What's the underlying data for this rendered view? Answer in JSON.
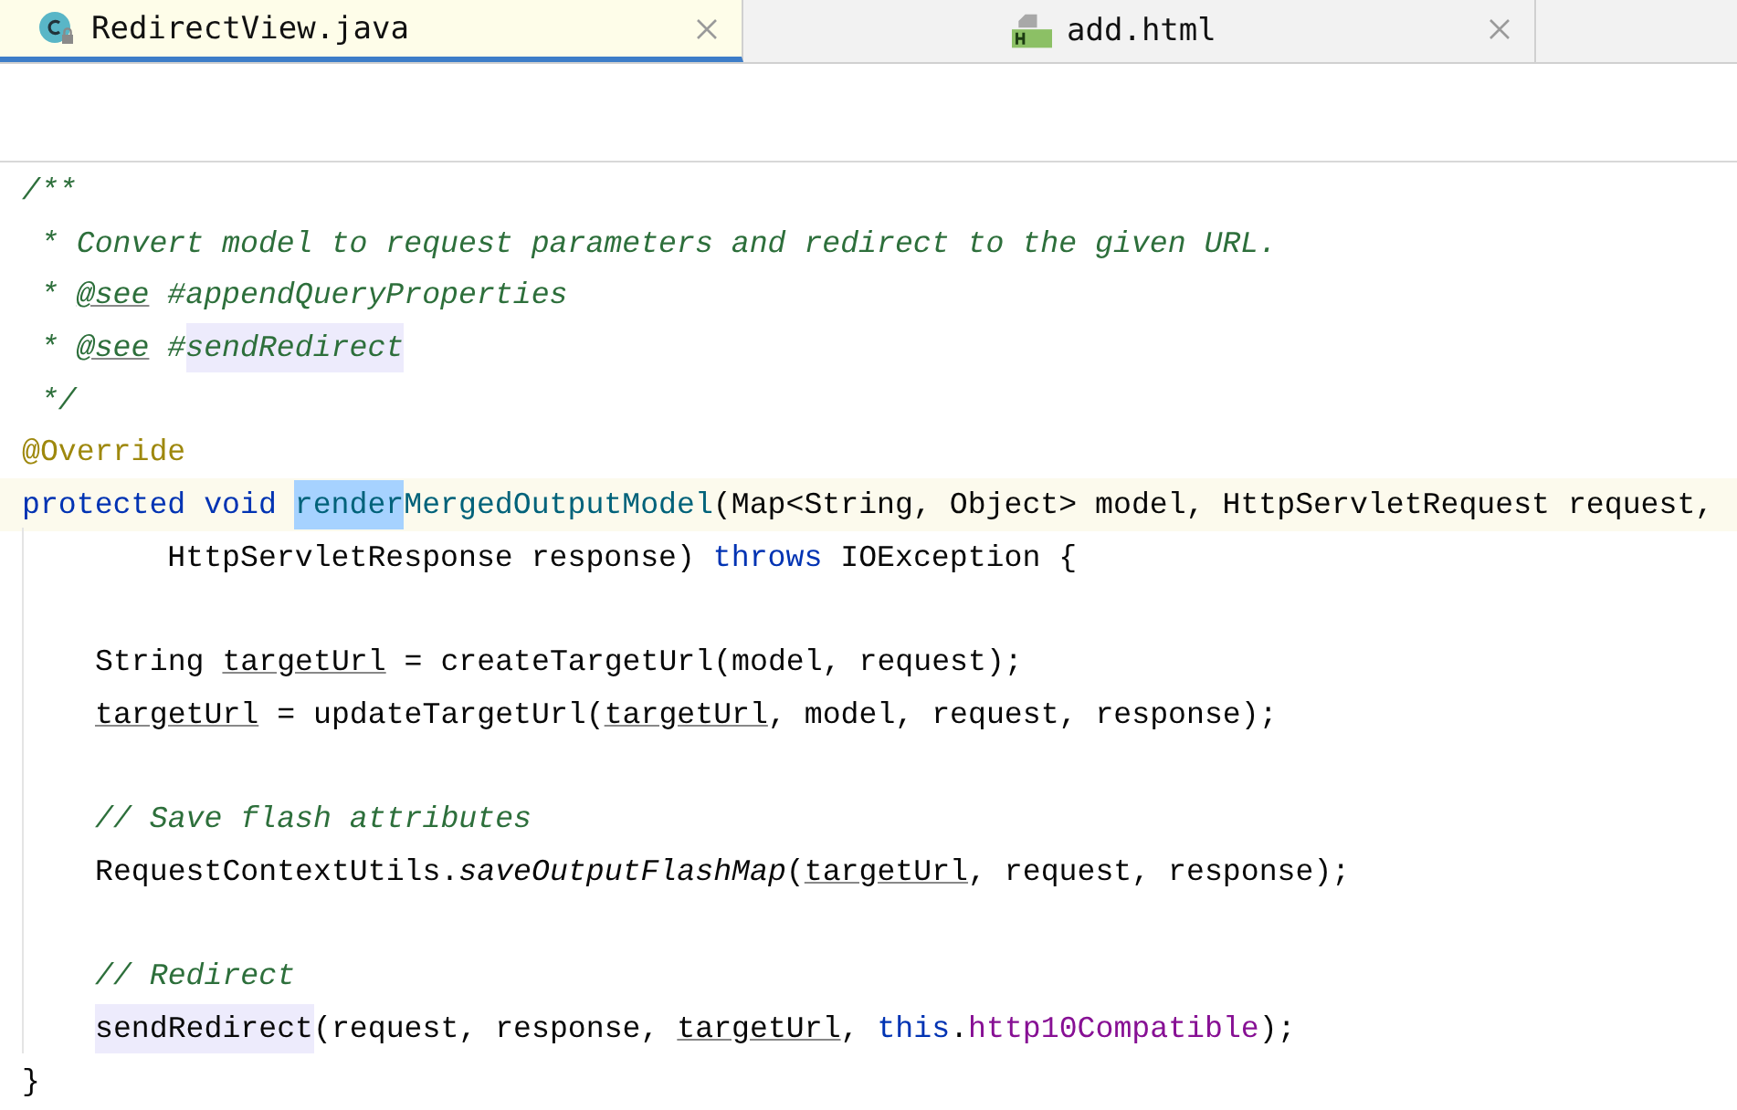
{
  "tabs": [
    {
      "label": "RedirectView.java",
      "kind": "java",
      "selected": true
    },
    {
      "label": "add.html",
      "kind": "html",
      "selected": false
    }
  ],
  "editor": {
    "lines": [
      {
        "kind": "code",
        "tokens": [
          {
            "kind": "comment",
            "text": "/**"
          }
        ]
      },
      {
        "kind": "code",
        "tokens": [
          {
            "kind": "comment",
            "text": " * Convert model to request parameters and redirect to the given URL."
          }
        ]
      },
      {
        "kind": "code",
        "tokens": [
          {
            "kind": "comment",
            "text": " * "
          },
          {
            "kind": "doctag",
            "text": "@see"
          },
          {
            "kind": "comment",
            "text": " #appendQueryProperties"
          }
        ]
      },
      {
        "kind": "code",
        "tokens": [
          {
            "kind": "comment",
            "text": " * "
          },
          {
            "kind": "doctag",
            "text": "@see"
          },
          {
            "kind": "comment",
            "text": " #"
          },
          {
            "kind": "comment-usage",
            "text": "sendRedirect"
          }
        ]
      },
      {
        "kind": "code",
        "tokens": [
          {
            "kind": "comment",
            "text": " */"
          }
        ]
      },
      {
        "kind": "code",
        "tokens": [
          {
            "kind": "annotation",
            "text": "@Override"
          }
        ]
      },
      {
        "kind": "code",
        "current": true,
        "tokens": [
          {
            "kind": "keyword",
            "text": "protected void "
          },
          {
            "kind": "decl-selected",
            "text": "render"
          },
          {
            "kind": "decl",
            "text": "MergedOutputModel"
          },
          {
            "kind": "plain",
            "text": "(Map<String, Object> model, HttpServletRequest request,"
          }
        ]
      },
      {
        "kind": "code",
        "tokens": [
          {
            "kind": "plain",
            "text": "        HttpServletResponse response) "
          },
          {
            "kind": "keyword",
            "text": "throws"
          },
          {
            "kind": "plain",
            "text": " IOException {"
          }
        ]
      },
      {
        "kind": "blank"
      },
      {
        "kind": "code",
        "indent": true,
        "tokens": [
          {
            "kind": "plain",
            "text": "String "
          },
          {
            "kind": "var",
            "text": "targetUrl"
          },
          {
            "kind": "plain",
            "text": " = createTargetUrl(model, request);"
          }
        ]
      },
      {
        "kind": "code",
        "indent": true,
        "tokens": [
          {
            "kind": "var",
            "text": "targetUrl"
          },
          {
            "kind": "plain",
            "text": " = updateTargetUrl("
          },
          {
            "kind": "var",
            "text": "targetUrl"
          },
          {
            "kind": "plain",
            "text": ", model, request, response);"
          }
        ]
      },
      {
        "kind": "blank"
      },
      {
        "kind": "code",
        "indent": true,
        "tokens": [
          {
            "kind": "comment",
            "text": "// Save flash attributes"
          }
        ]
      },
      {
        "kind": "code",
        "indent": true,
        "tokens": [
          {
            "kind": "plain",
            "text": "RequestContextUtils."
          },
          {
            "kind": "static",
            "text": "saveOutputFlashMap"
          },
          {
            "kind": "plain",
            "text": "("
          },
          {
            "kind": "var",
            "text": "targetUrl"
          },
          {
            "kind": "plain",
            "text": ", request, response);"
          }
        ]
      },
      {
        "kind": "blank"
      },
      {
        "kind": "code",
        "indent": true,
        "tokens": [
          {
            "kind": "comment",
            "text": "// Redirect"
          }
        ]
      },
      {
        "kind": "code",
        "indent": true,
        "tokens": [
          {
            "kind": "usage",
            "text": "sendRedirect"
          },
          {
            "kind": "plain",
            "text": "(request, response, "
          },
          {
            "kind": "var",
            "text": "targetUrl"
          },
          {
            "kind": "plain",
            "text": ", "
          },
          {
            "kind": "keyword",
            "text": "this"
          },
          {
            "kind": "plain",
            "text": "."
          },
          {
            "kind": "field",
            "text": "http10Compatible"
          },
          {
            "kind": "plain",
            "text": ");"
          }
        ]
      },
      {
        "kind": "code",
        "tokens": [
          {
            "kind": "plain",
            "text": "}"
          }
        ]
      }
    ]
  }
}
